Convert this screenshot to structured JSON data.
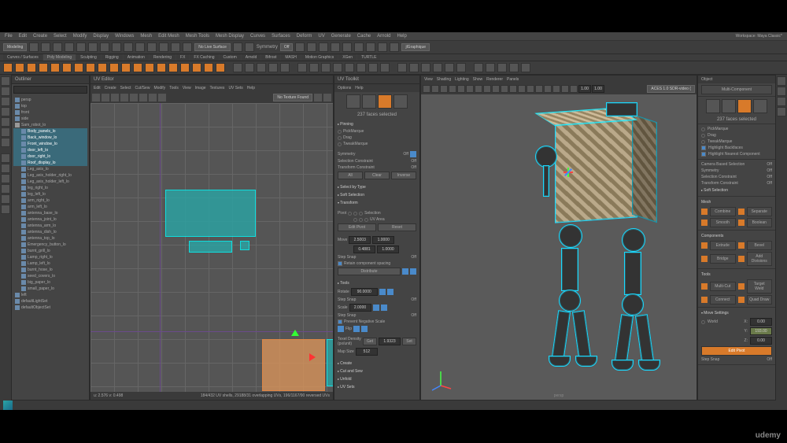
{
  "menubar": [
    "File",
    "Edit",
    "Create",
    "Select",
    "Modify",
    "Display",
    "Windows",
    "Mesh",
    "Edit Mesh",
    "Mesh Tools",
    "Mesh Display",
    "Curves",
    "Surfaces",
    "Deform",
    "UV",
    "Generate",
    "Cache",
    "Arnold",
    "Help"
  ],
  "workspace": {
    "label": "Workspace:",
    "value": "Maya Classic*"
  },
  "moduleDropdown": "Modeling",
  "shelfTabs": [
    "Curves / Surfaces",
    "Poly Modeling",
    "Sculpting",
    "Rigging",
    "Animation",
    "Rendering",
    "FX",
    "FX Caching",
    "Custom",
    "Arnold",
    "Bifrost",
    "MASH",
    "Motion Graphics",
    "XGen",
    "TURTLE"
  ],
  "shelfActive": "Poly Modeling",
  "renderDropdown": "No Live Surface",
  "symmetry": {
    "label": "Symmetry",
    "value": "Off"
  },
  "gridDropdown": "jlGraphique",
  "outliner": {
    "title": "Outliner",
    "searchPlaceholder": "",
    "items": [
      {
        "name": "persp",
        "type": "cam"
      },
      {
        "name": "top",
        "type": "cam"
      },
      {
        "name": "front",
        "type": "cam"
      },
      {
        "name": "side",
        "type": "cam"
      },
      {
        "name": "Sam_robot_lo",
        "type": "grp",
        "sel": false,
        "children": [
          {
            "name": "Body_panels_lo",
            "sel": true
          },
          {
            "name": "Back_window_lo",
            "sel": true
          },
          {
            "name": "Front_window_lo",
            "sel": true
          },
          {
            "name": "door_left_lo",
            "sel": true
          },
          {
            "name": "door_right_lo",
            "sel": true
          },
          {
            "name": "Roof_display_lo",
            "sel": true
          },
          {
            "name": "Leg_axis_lo"
          },
          {
            "name": "Leg_axis_holder_right_lo"
          },
          {
            "name": "Leg_axis_holder_left_lo"
          },
          {
            "name": "leg_right_lo"
          },
          {
            "name": "leg_left_lo"
          },
          {
            "name": "arm_right_lo"
          },
          {
            "name": "arm_left_lo"
          },
          {
            "name": "antenna_base_lo"
          },
          {
            "name": "antenna_joint_lo"
          },
          {
            "name": "antenna_arm_lo"
          },
          {
            "name": "antenna_dish_lo"
          },
          {
            "name": "antenna_top_lo"
          },
          {
            "name": "Emergency_button_lo"
          },
          {
            "name": "burnt_grill_lo"
          },
          {
            "name": "Lamp_right_lo"
          },
          {
            "name": "Lamp_left_lo"
          },
          {
            "name": "burnt_hose_lo"
          },
          {
            "name": "seed_covers_lo"
          },
          {
            "name": "big_paper_lo"
          },
          {
            "name": "small_paper_lo"
          }
        ]
      },
      {
        "name": "left",
        "type": "cam"
      },
      {
        "name": "defaultLightSet",
        "type": "set"
      },
      {
        "name": "defaultObjectSet",
        "type": "set"
      }
    ]
  },
  "uvEditor": {
    "title": "UV Editor",
    "menu": [
      "Edit",
      "Create",
      "Select",
      "Cut/Sew",
      "Modify",
      "Tools",
      "View",
      "Image",
      "Textures",
      "UV Sets",
      "Help"
    ],
    "textureDropdown": "No Texture Found",
    "status": {
      "left": "u: 2.576  v: 0.498",
      "right": "184/432 UV shells, 29188/31 overlapping UVs, 196/1167/90 reversed UVs"
    }
  },
  "uvToolkit": {
    "title": "UV Toolkit",
    "tabs": [
      "Options",
      "Help"
    ],
    "facesSelected": "237 faces selected",
    "pinning": {
      "title": "Pinning",
      "items": [
        "PickMarque",
        "Drag",
        "TweakMarque"
      ]
    },
    "symmetry": {
      "label": "Symmetry",
      "value": "Off"
    },
    "selectionConstraint": {
      "label": "Selection Constraint",
      "value": "Off"
    },
    "transformConstraint": {
      "label": "Transform Constraint",
      "value": "Off"
    },
    "btns": {
      "all": "All",
      "clear": "Clear",
      "inverse": "Inverse"
    },
    "sections": {
      "selectByType": "Select by Type",
      "softSelection": "Soft Selection",
      "transform": "Transform"
    },
    "pivot": {
      "label": "Pivot",
      "options": [
        "Selection",
        "UV Area"
      ]
    },
    "editPivot": "Edit Pivot",
    "reset": "Reset",
    "move": {
      "label": "Move",
      "u": "2.5003",
      "v": "0.4881",
      "offsetU": "1.0000",
      "offsetV": "1.0000"
    },
    "stepSnap": {
      "label": "Step Snap",
      "value": "Off"
    },
    "retainSpacing": {
      "label": "Retain component spacing",
      "checked": true
    },
    "distribute": "Distribute",
    "tools": "Tools",
    "rotate": {
      "label": "Rotate",
      "value": "90.0000"
    },
    "stepSnap2": {
      "label": "Step Snap",
      "value": "Off"
    },
    "scale": {
      "label": "Scale",
      "value": "2.0000"
    },
    "stepSnap3": {
      "label": "Step Snap",
      "value": "Off"
    },
    "preventNeg": {
      "label": "Prevent Negative Scale",
      "checked": true
    },
    "flip": "Flip",
    "texelDensity": {
      "label": "Texel Density (px/unit)",
      "get": "Get",
      "value": "1.9323",
      "set": "Set"
    },
    "mapSize": {
      "label": "Map Size",
      "value": "512"
    },
    "bottomSections": [
      "Create",
      "Cut and Sew",
      "Unfold",
      "UV Sets"
    ]
  },
  "viewport": {
    "menu": [
      "View",
      "Shading",
      "Lighting",
      "Show",
      "Renderer",
      "Panels"
    ],
    "colorSpace": "ACES 1.0 SDR-video (",
    "cameraLabel": "persp"
  },
  "props": {
    "tabs": [
      "Object",
      "???"
    ],
    "multiComponent": "Multi-Component",
    "facesSelected": "237 faces selected",
    "selOptions": [
      "PickMarque",
      "Drag",
      "TweakMarque",
      "Highlight Backfaces",
      "Highlight Nearest Component"
    ],
    "cameraBased": {
      "label": "Camera Based Selection",
      "value": "Off"
    },
    "symmetry": {
      "label": "Symmetry",
      "value": "Off"
    },
    "selectionConstraint": {
      "label": "Selection Constraint",
      "value": "Off"
    },
    "transformConstraint": {
      "label": "Transform Constraint",
      "value": "Off"
    },
    "softSelection": "Soft Selection",
    "mesh": {
      "title": "Mesh",
      "combine": "Combine",
      "separate": "Separate",
      "smooth": "Smooth",
      "boolean": "Boolean"
    },
    "components": {
      "title": "Components",
      "extrude": "Extrude",
      "bevel": "Bevel",
      "bridge": "Bridge",
      "addDivisions": "Add Divisions"
    },
    "toolsTitle": "Tools",
    "tools": {
      "multiCut": "Multi-Cut",
      "targetWeld": "Target Weld",
      "connect": "Connect",
      "quadDraw": "Quad Draw"
    },
    "moveSettings": "Move Settings",
    "world": {
      "label": "World",
      "x": "X:",
      "xv": "0.00",
      "y": "Y:",
      "yv": "193.00",
      "z": "Z:",
      "zv": "0.00"
    },
    "editPivot": "Edit Pivot",
    "stepSnap": {
      "label": "Step Snap",
      "value": "Off"
    }
  },
  "statusbar": {
    "anim": ""
  },
  "watermark": "udemy"
}
